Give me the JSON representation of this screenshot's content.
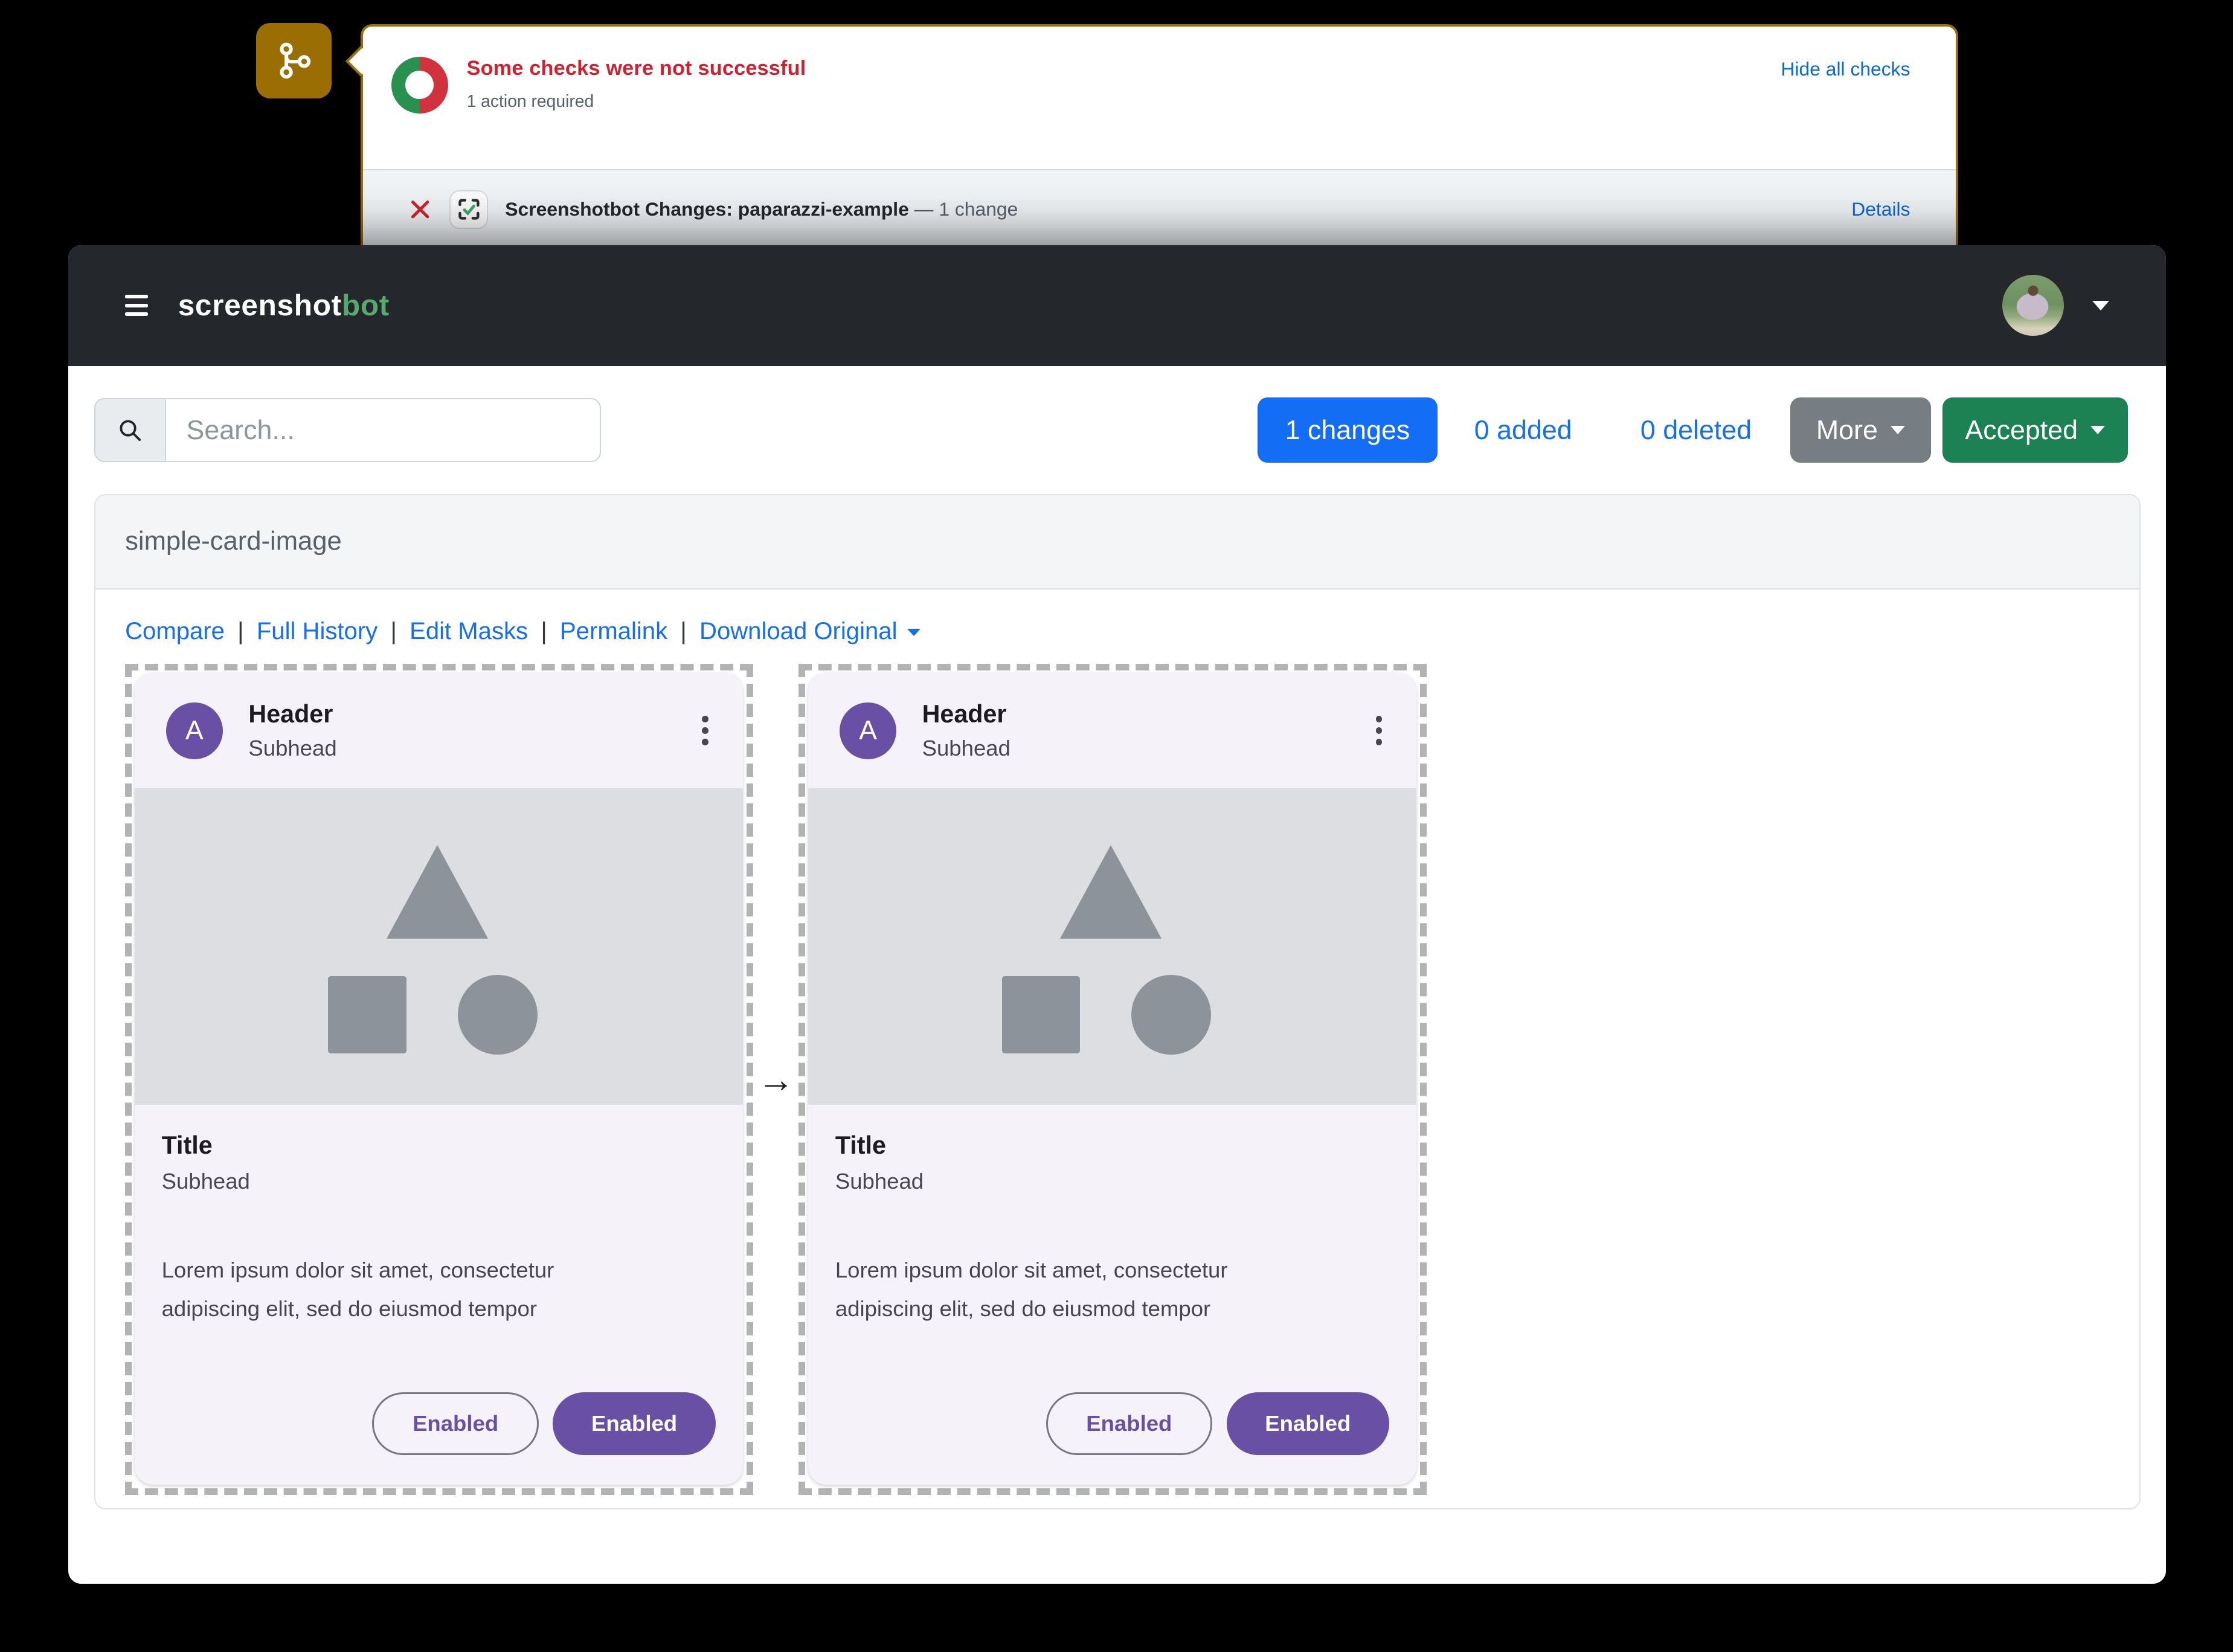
{
  "checks_panel": {
    "status_title": "Some checks were not successful",
    "status_subtitle": "1 action required",
    "hide_all_link": "Hide all checks",
    "check_name": "Screenshotbot Changes: paparazzi-example",
    "check_suffix": "— 1 change",
    "details_link": "Details",
    "icons": {
      "left_badge": "git-branch-icon",
      "status_ring": "half-red-half-green-donut",
      "fail": "red-x-icon",
      "app": "screenshotbot-viewfinder-check-icon"
    },
    "colors": {
      "panel_border": "#9a6e03",
      "title_red": "#cf222e",
      "ring_red": "#d1333e",
      "ring_green": "#299150",
      "link_blue": "#0969da",
      "muted_gray": "#57606a",
      "row_bg": "#f1f4f7"
    }
  },
  "navbar": {
    "brand_primary": "screenshot",
    "brand_accent": "bot",
    "colors": {
      "bg": "#24282c",
      "accent_green": "#57a96d"
    }
  },
  "toolbar": {
    "search_placeholder": "Search...",
    "changes_button": "1 changes",
    "added_link": "0 added",
    "deleted_link": "0 deleted",
    "more_button": "More",
    "accepted_button": "Accepted",
    "colors": {
      "primary_blue": "#146ef5",
      "secondary_gray": "#767d83",
      "success_green": "#1c8254"
    }
  },
  "report": {
    "title": "simple-card-image",
    "links": [
      "Compare",
      "Full History",
      "Edit Masks",
      "Permalink",
      "Download Original"
    ],
    "separator": "|",
    "arrow": "→"
  },
  "material_card": {
    "avatar_letter": "A",
    "header": "Header",
    "header_subhead": "Subhead",
    "title": "Title",
    "title_subhead": "Subhead",
    "body_line1": "Lorem ipsum dolor sit amet, consectetur",
    "body_line2": "adipiscing elit, sed do eiusmod tempor",
    "outlined_button": "Enabled",
    "filled_button": "Enabled",
    "colors": {
      "purple": "#6950a5",
      "media_gray": "#dcdee1",
      "shape_gray": "#8c939a",
      "card_bg": "#f6f2f9"
    }
  }
}
